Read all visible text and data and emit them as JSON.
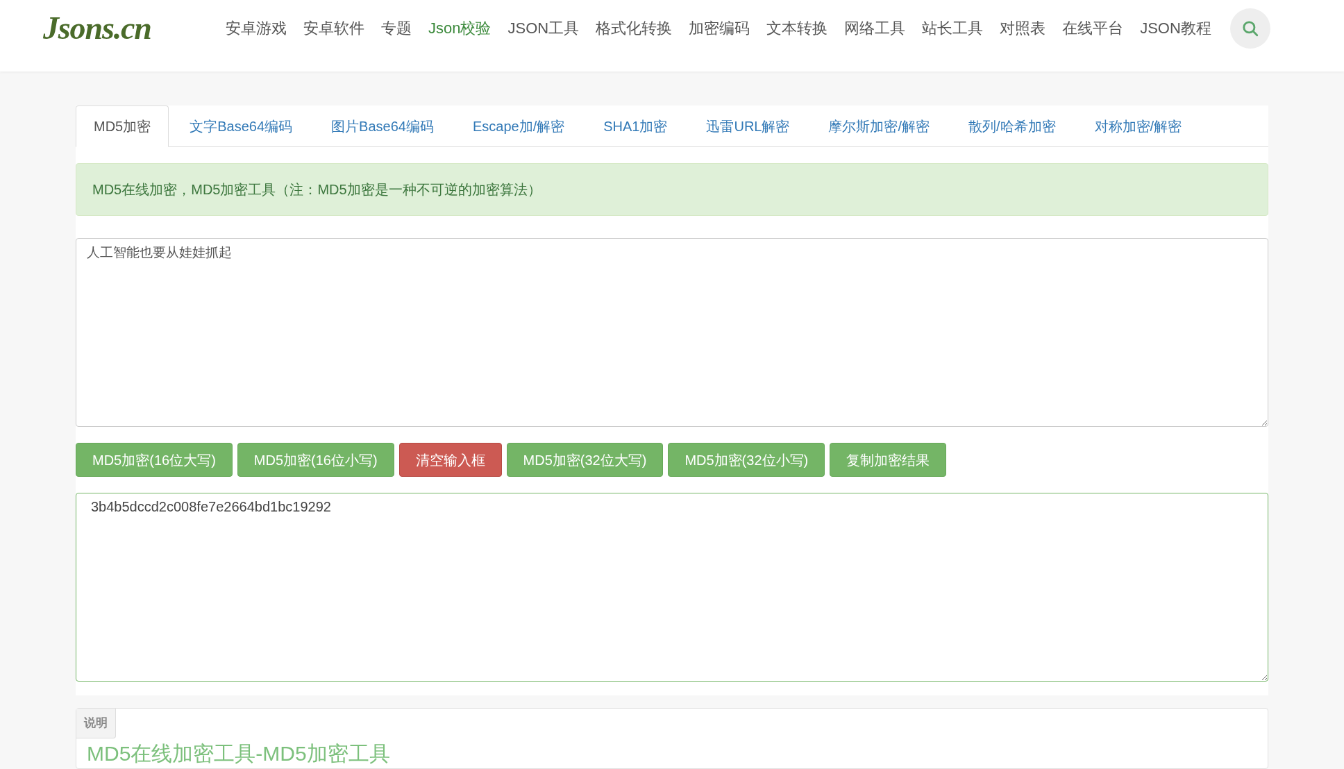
{
  "logo": "Jsons.cn",
  "nav": [
    {
      "label": "安卓游戏",
      "selected": false
    },
    {
      "label": "安卓软件",
      "selected": false
    },
    {
      "label": "专题",
      "selected": false
    },
    {
      "label": "Json校验",
      "selected": true
    },
    {
      "label": "JSON工具",
      "selected": false
    },
    {
      "label": "格式化转换",
      "selected": false
    },
    {
      "label": "加密编码",
      "selected": false
    },
    {
      "label": "文本转换",
      "selected": false
    },
    {
      "label": "网络工具",
      "selected": false
    },
    {
      "label": "站长工具",
      "selected": false
    },
    {
      "label": "对照表",
      "selected": false
    },
    {
      "label": "在线平台",
      "selected": false
    },
    {
      "label": "JSON教程",
      "selected": false
    }
  ],
  "tabs": [
    {
      "label": "MD5加密",
      "selected": true
    },
    {
      "label": "文字Base64编码",
      "selected": false
    },
    {
      "label": "图片Base64编码",
      "selected": false
    },
    {
      "label": "Escape加/解密",
      "selected": false
    },
    {
      "label": "SHA1加密",
      "selected": false
    },
    {
      "label": "迅雷URL解密",
      "selected": false
    },
    {
      "label": "摩尔斯加密/解密",
      "selected": false
    },
    {
      "label": "散列/哈希加密",
      "selected": false
    },
    {
      "label": "对称加密/解密",
      "selected": false
    }
  ],
  "notice": "MD5在线加密，MD5加密工具（注：MD5加密是一种不可逆的加密算法）",
  "input_value": "人工智能也要从娃娃抓起",
  "buttons": [
    {
      "label": "MD5加密(16位大写)",
      "kind": "success"
    },
    {
      "label": "MD5加密(16位小写)",
      "kind": "success"
    },
    {
      "label": "清空输入框",
      "kind": "danger"
    },
    {
      "label": "MD5加密(32位大写)",
      "kind": "success"
    },
    {
      "label": "MD5加密(32位小写)",
      "kind": "success"
    },
    {
      "label": "复制加密结果",
      "kind": "success"
    }
  ],
  "output_value": "3b4b5dccd2c008fe7e2664bd1bc19292",
  "info_panel": {
    "tab": "说明",
    "heading": "MD5在线加密工具-MD5加密工具"
  }
}
